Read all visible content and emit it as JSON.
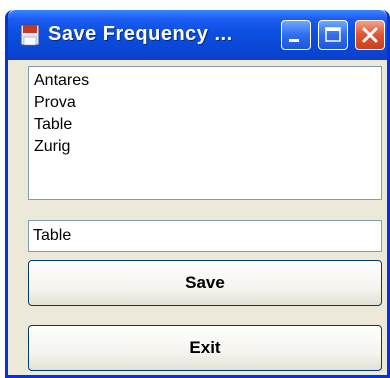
{
  "window": {
    "title": "Save Frequency ...",
    "icon": "floppy-disk-icon",
    "controls": [
      "minimize-icon",
      "maximize-icon",
      "close-icon"
    ]
  },
  "list": {
    "items": [
      "Antares",
      "Prova",
      "Table",
      "Zurig"
    ]
  },
  "name_field": {
    "value": "Table"
  },
  "buttons": {
    "save_label": "Save",
    "exit_label": "Exit"
  },
  "colors": {
    "titlebar": "#0b4fe0",
    "window_bg": "#ece9d8",
    "close_button": "#e0532e"
  }
}
